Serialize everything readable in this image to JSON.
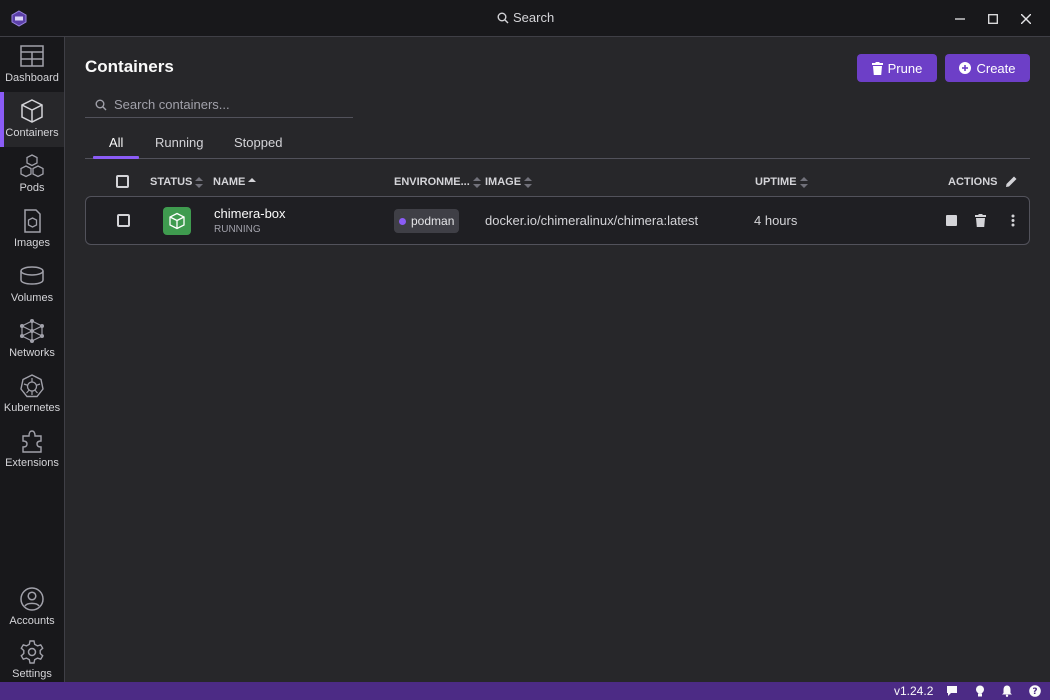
{
  "titlebar": {
    "search_label": "Search",
    "logo_icon": "podman-desktop-logo",
    "controls": [
      "minimize-icon",
      "maximize-icon",
      "close-icon"
    ]
  },
  "sidebar": {
    "items": [
      {
        "label": "Dashboard",
        "icon": "dashboard-icon"
      },
      {
        "label": "Containers",
        "icon": "container-cube-icon",
        "active": true
      },
      {
        "label": "Pods",
        "icon": "pods-icon"
      },
      {
        "label": "Images",
        "icon": "image-icon"
      },
      {
        "label": "Volumes",
        "icon": "volume-icon"
      },
      {
        "label": "Networks",
        "icon": "network-icon"
      },
      {
        "label": "Kubernetes",
        "icon": "kubernetes-icon"
      },
      {
        "label": "Extensions",
        "icon": "puzzle-icon"
      }
    ],
    "bottom_items": [
      {
        "label": "Accounts",
        "icon": "account-icon"
      },
      {
        "label": "Settings",
        "icon": "gear-icon"
      }
    ]
  },
  "page": {
    "title": "Containers",
    "prune_label": "Prune",
    "create_label": "Create",
    "search_placeholder": "Search containers...",
    "tabs": [
      {
        "label": "All",
        "active": true
      },
      {
        "label": "Running"
      },
      {
        "label": "Stopped"
      }
    ]
  },
  "table": {
    "columns": {
      "status": "STATUS",
      "name": "NAME",
      "environment": "ENVIRONME...",
      "image": "IMAGE",
      "uptime": "UPTIME",
      "actions": "ACTIONS"
    },
    "rows": [
      {
        "name": "chimera-box",
        "state": "RUNNING",
        "environment": "podman",
        "image": "docker.io/chimeralinux/chimera:latest",
        "uptime": "4 hours"
      }
    ]
  },
  "statusbar": {
    "version": "v1.24.2",
    "icons": [
      "chat-icon",
      "lightbulb-icon",
      "bell-icon",
      "help-icon"
    ]
  },
  "colors": {
    "accent": "#8b5cf6",
    "button": "#6d3fc7",
    "statusbar": "#4c2b85",
    "running": "#3f9b4f"
  }
}
